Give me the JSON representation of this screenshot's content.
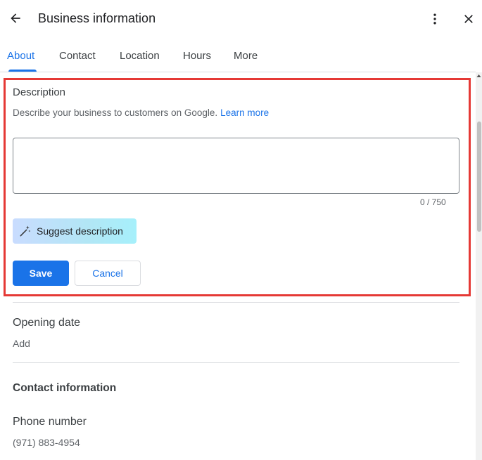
{
  "header": {
    "title": "Business information"
  },
  "tabs": [
    {
      "label": "About",
      "active": true
    },
    {
      "label": "Contact",
      "active": false
    },
    {
      "label": "Location",
      "active": false
    },
    {
      "label": "Hours",
      "active": false
    },
    {
      "label": "More",
      "active": false
    }
  ],
  "description": {
    "heading": "Description",
    "help_text": "Describe your business to customers on Google.",
    "learn_more": "Learn more",
    "value": "",
    "char_count": "0 / 750",
    "suggest_label": "Suggest description",
    "save_label": "Save",
    "cancel_label": "Cancel"
  },
  "opening_date": {
    "label": "Opening date",
    "value": "Add"
  },
  "contact": {
    "heading": "Contact information",
    "phone_label": "Phone number",
    "phone_value": "(971) 883-4954"
  },
  "colors": {
    "accent": "#1a73e8",
    "highlight_border": "#e53935",
    "divider": "#dadce0"
  },
  "icons": {
    "back": "arrow-left-icon",
    "more": "more-vert-icon",
    "close": "close-icon",
    "suggest": "magic-wand-icon"
  }
}
